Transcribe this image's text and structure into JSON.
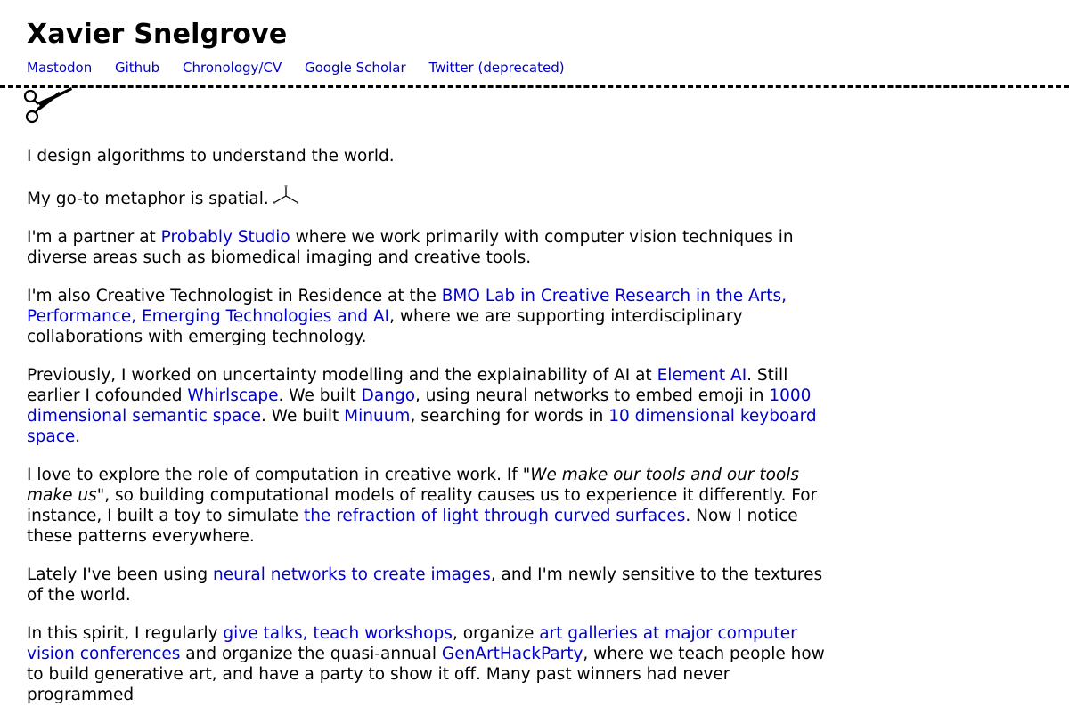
{
  "header": {
    "title": "Xavier Snelgrove",
    "nav": [
      "Mastodon",
      "Github",
      "Chronology/CV",
      "Google Scholar",
      "Twitter (deprecated)"
    ]
  },
  "icons": {
    "divider": "scissors-icon",
    "metaphor": "3d-axes-icon"
  },
  "colors": {
    "link": "#0000cc",
    "text": "#000000",
    "background": "#ffffff"
  },
  "content": {
    "p1": "I design algorithms to understand the world.",
    "p2": "My go-to metaphor is spatial.",
    "p3": {
      "t1": "I'm a partner at ",
      "link1": "Probably Studio",
      "t2": " where we work primarily with computer vision techniques in diverse areas such as biomedical imaging and creative tools."
    },
    "p4": {
      "t1": "I'm also Creative Technologist in Residence at the ",
      "link1": "BMO Lab in Creative Research in the Arts, Performance, Emerging Technologies and AI",
      "t2": ", where we are supporting interdisciplinary collaborations with emerging technology."
    },
    "p5": {
      "t1": "Previously, I worked on uncertainty modelling and the explainability of AI at ",
      "link1": "Element AI",
      "t2": ". Still earlier I cofounded ",
      "link2": "Whirlscape",
      "t3": ". We built ",
      "link3": "Dango",
      "t4": ", using neural networks to embed emoji in ",
      "link4": "1000 dimensional semantic space",
      "t5": ". We built ",
      "link5": "Minuum",
      "t6": ", searching for words in ",
      "link6": "10 dimensional keyboard space",
      "t7": "."
    },
    "p6": {
      "t1": "I love to explore the role of computation in creative work. If \"",
      "em1": "We make our tools and our tools make us",
      "t2": "\", so building computational models of reality causes us to experience it differently. For instance, I built a toy to simulate ",
      "link1": "the refraction of light through curved surfaces",
      "t3": ". Now I notice these patterns everywhere."
    },
    "p7": {
      "t1": "Lately I've been using ",
      "link1": "neural networks to create images",
      "t2": ", and I'm newly sensitive to the textures of the world."
    },
    "p8": {
      "t1": "In this spirit, I regularly ",
      "link1": "give talks, teach workshops",
      "t2": ", organize ",
      "link2": "art galleries at major computer vision conferences",
      "t3": " and organize the quasi-annual ",
      "link3": "GenArtHackParty",
      "t4": ", where we teach people how to build generative art, and have a party to show it off. Many past winners had never programmed"
    }
  }
}
